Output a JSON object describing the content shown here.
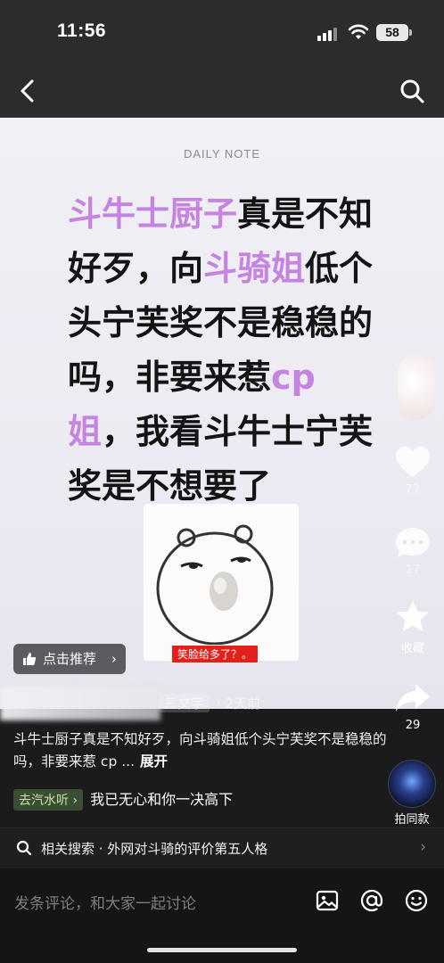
{
  "status_bar": {
    "time": "11:56",
    "battery": "58"
  },
  "note": {
    "header": "DAILY NOTE",
    "line1_hl": "斗牛士厨子",
    "line1_rest": "真是不知",
    "line2_a": "好歹，向",
    "line2_hl": "斗骑姐",
    "line2_b": "低个",
    "line3": "头宁芙奖不是稳稳的",
    "line4_a": "吗，非要来惹",
    "line4_hl": "cp",
    "line5_hl": "姐",
    "line5_rest": "，我看斗牛士宁芙",
    "line6": "奖是不想要了"
  },
  "meme": {
    "caption": "笑脸给多了？。"
  },
  "recommend": {
    "label": "点击推荐",
    "chevron": "›"
  },
  "rail": {
    "likes": "77",
    "comments": "17",
    "favorite_label": "收藏",
    "shares": "29"
  },
  "author": {
    "tag": "三文字",
    "time_ago": "· 2天前"
  },
  "caption": {
    "text": "斗牛士厨子真是不知好歹，向斗骑姐低个头宁芙奖不是稳稳的吗，非要来惹 cp ...",
    "expand": "展开"
  },
  "music": {
    "tag": "去汽水听 ›",
    "title": "我已无心和你一决高下"
  },
  "same_style": {
    "label": "拍同款"
  },
  "related": {
    "text": "相关搜索 · 外网对斗骑的评价第五人格",
    "chevron": "›"
  },
  "comment": {
    "placeholder": "发条评论，和大家一起讨论"
  },
  "colors": {
    "highlight": "#c584e0",
    "nav_bg": "#2c2c2e",
    "meme_caption_bg": "#e3201b"
  },
  "icons": [
    "back-icon",
    "search-icon",
    "heart-icon",
    "comment-icon",
    "star-icon",
    "share-icon",
    "image-icon",
    "at-icon",
    "emoji-icon"
  ]
}
